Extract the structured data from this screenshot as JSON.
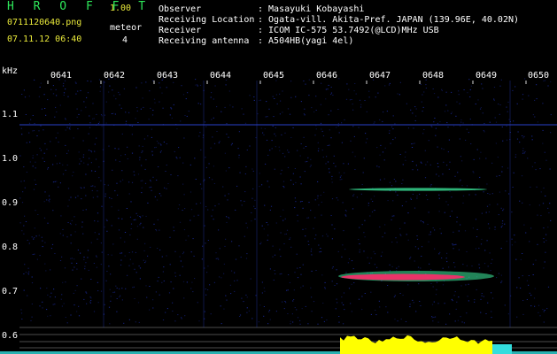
{
  "header": {
    "app_name": "H R O F F T",
    "version": "1.00",
    "file_name": "0711120640.png",
    "timestamp": "07.11.12 06:40",
    "meteor_label": "meteor",
    "meteor_count": "4"
  },
  "info": [
    {
      "label": "Observer",
      "value": ": Masayuki Kobayashi"
    },
    {
      "label": "Receiving Location",
      "value": ": Ogata-vill. Akita-Pref. JAPAN (139.96E, 40.02N)"
    },
    {
      "label": "Receiver",
      "value": ": ICOM IC-575 53.7492(@LCD)MHz USB"
    },
    {
      "label": "Receiving antenna",
      "value": ": A504HB(yagi 4el)"
    }
  ],
  "axis": {
    "unit": "kHz",
    "time_ticks": [
      "0641",
      "0642",
      "0643",
      "0644",
      "0645",
      "0646",
      "0647",
      "0648",
      "0649",
      "0650"
    ],
    "freq_ticks": [
      "1.1",
      "1.0",
      "0.9",
      "0.8",
      "0.7",
      "0.6"
    ]
  },
  "colors": {
    "grid": "#d8d8d8",
    "title_green": "#2ee85a",
    "label_yellow": "#e8e83a",
    "text": "#ffffff",
    "noise_blue": "#1a2a9a",
    "meteor_red": "#ff2a6a",
    "meteor_green": "#3ef0a0",
    "power_yellow": "#ffff00",
    "power_cyan": "#33dddd"
  }
}
